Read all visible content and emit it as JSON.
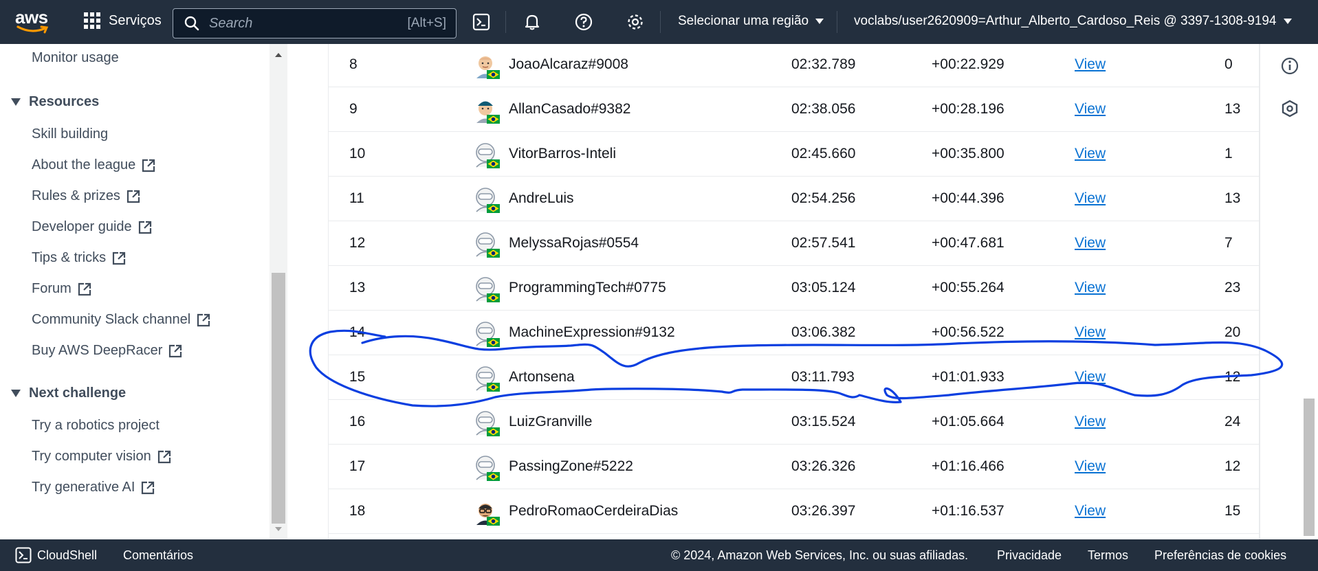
{
  "topnav": {
    "logo_text": "aws",
    "services_label": "Serviços",
    "search_placeholder": "Search",
    "search_hint": "[Alt+S]",
    "region_label": "Selecionar uma região",
    "account_label": "voclabs/user2620909=Arthur_Alberto_Cardoso_Reis @ 3397-1308-9194"
  },
  "sidebar": {
    "monitor_usage": "Monitor usage",
    "resources_heading": "Resources",
    "resources_items": [
      {
        "label": "Skill building",
        "external": false
      },
      {
        "label": "About the league",
        "external": true
      },
      {
        "label": "Rules & prizes",
        "external": true
      },
      {
        "label": "Developer guide",
        "external": true
      },
      {
        "label": "Tips & tricks",
        "external": true
      },
      {
        "label": "Forum",
        "external": true
      },
      {
        "label": "Community Slack channel",
        "external": true
      },
      {
        "label": "Buy AWS DeepRacer",
        "external": true
      }
    ],
    "next_heading": "Next challenge",
    "next_items": [
      {
        "label": "Try a robotics project",
        "external": false
      },
      {
        "label": "Try computer vision",
        "external": true
      },
      {
        "label": "Try generative AI",
        "external": true
      }
    ]
  },
  "leaderboard": {
    "rows": [
      {
        "rank": "8",
        "name": "JoaoAlcaraz#9008",
        "time": "02:32.789",
        "gap": "+00:22.929",
        "view": "View",
        "count": "0",
        "avatar": "person"
      },
      {
        "rank": "9",
        "name": "AllanCasado#9382",
        "time": "02:38.056",
        "gap": "+00:28.196",
        "view": "View",
        "count": "13",
        "avatar": "person-cap"
      },
      {
        "rank": "10",
        "name": "VitorBarros-Inteli",
        "time": "02:45.660",
        "gap": "+00:35.800",
        "view": "View",
        "count": "1",
        "avatar": "helmet"
      },
      {
        "rank": "11",
        "name": "AndreLuis",
        "time": "02:54.256",
        "gap": "+00:44.396",
        "view": "View",
        "count": "13",
        "avatar": "helmet"
      },
      {
        "rank": "12",
        "name": "MelyssaRojas#0554",
        "time": "02:57.541",
        "gap": "+00:47.681",
        "view": "View",
        "count": "7",
        "avatar": "helmet"
      },
      {
        "rank": "13",
        "name": "ProgrammingTech#0775",
        "time": "03:05.124",
        "gap": "+00:55.264",
        "view": "View",
        "count": "23",
        "avatar": "helmet"
      },
      {
        "rank": "14",
        "name": "MachineExpression#9132",
        "time": "03:06.382",
        "gap": "+00:56.522",
        "view": "View",
        "count": "20",
        "avatar": "helmet"
      },
      {
        "rank": "15",
        "name": "Artonsena",
        "time": "03:11.793",
        "gap": "+01:01.933",
        "view": "View",
        "count": "12",
        "avatar": "helmet"
      },
      {
        "rank": "16",
        "name": "LuizGranville",
        "time": "03:15.524",
        "gap": "+01:05.664",
        "view": "View",
        "count": "24",
        "avatar": "helmet"
      },
      {
        "rank": "17",
        "name": "PassingZone#5222",
        "time": "03:26.326",
        "gap": "+01:16.466",
        "view": "View",
        "count": "12",
        "avatar": "helmet"
      },
      {
        "rank": "18",
        "name": "PedroRomaoCerdeiraDias",
        "time": "03:26.397",
        "gap": "+01:16.537",
        "view": "View",
        "count": "15",
        "avatar": "person-glasses"
      }
    ]
  },
  "footer": {
    "cloudshell": "CloudShell",
    "feedback": "Comentários",
    "copyright": "© 2024, Amazon Web Services, Inc. ou suas afiliadas.",
    "privacy": "Privacidade",
    "terms": "Termos",
    "cookies": "Preferências de cookies"
  },
  "colors": {
    "nav_bg": "#232f3e",
    "link": "#0972d3",
    "annotation": "#0b3fe0",
    "aws_orange": "#ff9900"
  }
}
